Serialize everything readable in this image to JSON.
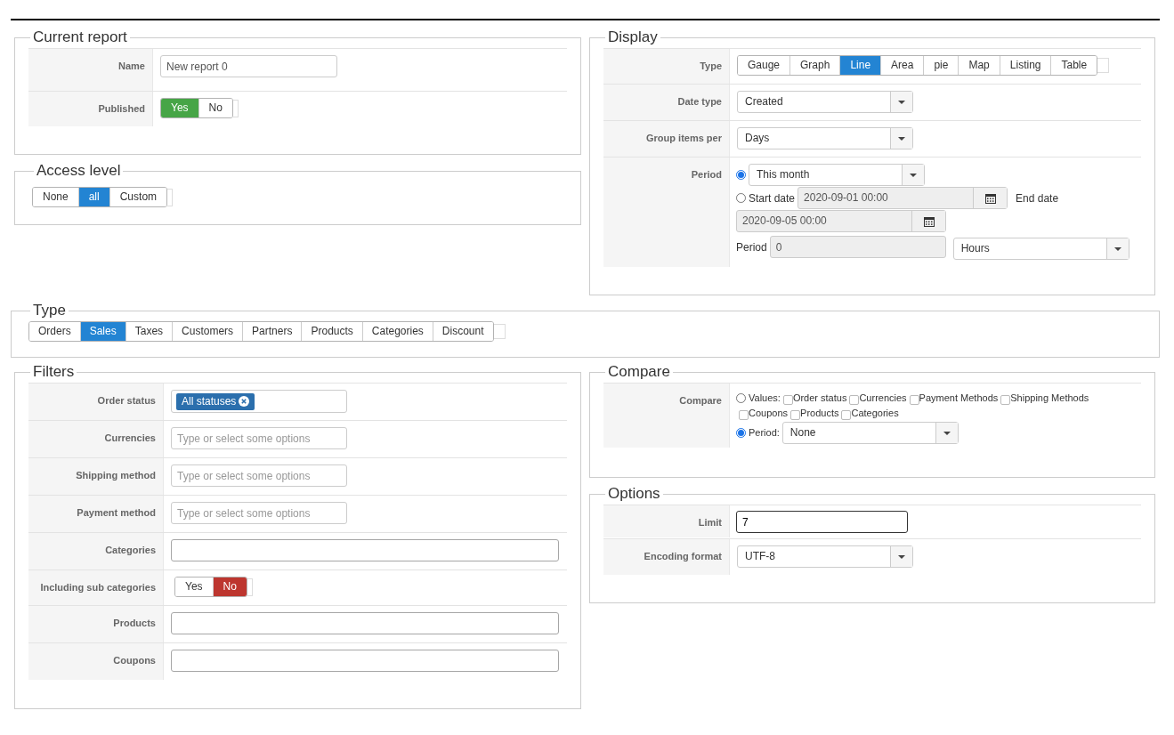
{
  "current_report": {
    "title": "Current report",
    "name": {
      "label": "Name",
      "value": "New report 0"
    },
    "published": {
      "label": "Published",
      "options": [
        {
          "label": "Yes",
          "selected": true,
          "color": "#46a546"
        },
        {
          "label": "No",
          "selected": false
        }
      ]
    }
  },
  "access_level": {
    "title": "Access level",
    "options": [
      {
        "label": "None",
        "selected": false
      },
      {
        "label": "all",
        "selected": true,
        "color": "#2384d3"
      },
      {
        "label": "Custom",
        "selected": false
      }
    ]
  },
  "display": {
    "title": "Display",
    "type": {
      "label": "Type",
      "options": [
        {
          "label": "Gauge",
          "selected": false
        },
        {
          "label": "Graph",
          "selected": false
        },
        {
          "label": "Line",
          "selected": true
        },
        {
          "label": "Area",
          "selected": false
        },
        {
          "label": "pie",
          "selected": false
        },
        {
          "label": "Map",
          "selected": false
        },
        {
          "label": "Listing",
          "selected": false
        },
        {
          "label": "Table",
          "selected": false
        }
      ]
    },
    "date_type": {
      "label": "Date type",
      "value": "Created"
    },
    "group_items_per": {
      "label": "Group items per",
      "value": "Days"
    },
    "period": {
      "label": "Period",
      "preset": {
        "selected": true,
        "value": "This month"
      },
      "range": {
        "selected": false,
        "start_label": "Start date",
        "start_value": "2020-09-01 00:00",
        "end_label": "End date",
        "end_value": "2020-09-05 00:00"
      },
      "period_label": "Period",
      "period_value": "0",
      "unit": "Hours"
    }
  },
  "type": {
    "title": "Type",
    "options": [
      {
        "label": "Orders",
        "selected": false
      },
      {
        "label": "Sales",
        "selected": true
      },
      {
        "label": "Taxes",
        "selected": false
      },
      {
        "label": "Customers",
        "selected": false
      },
      {
        "label": "Partners",
        "selected": false
      },
      {
        "label": "Products",
        "selected": false
      },
      {
        "label": "Categories",
        "selected": false
      },
      {
        "label": "Discount",
        "selected": false
      }
    ]
  },
  "filters": {
    "title": "Filters",
    "rows": [
      {
        "kind": "tags",
        "label": "Order status",
        "tags": [
          "All statuses"
        ]
      },
      {
        "kind": "multiselect",
        "label": "Currencies",
        "placeholder": "Type or select some options"
      },
      {
        "kind": "multiselect",
        "label": "Shipping method",
        "placeholder": "Type or select some options"
      },
      {
        "kind": "multiselect",
        "label": "Payment method",
        "placeholder": "Type or select some options"
      },
      {
        "kind": "text",
        "label": "Categories"
      },
      {
        "kind": "toggle",
        "label": "Including sub categories",
        "options": [
          {
            "label": "Yes",
            "selected": false
          },
          {
            "label": "No",
            "selected": true,
            "color": "#bd362f"
          }
        ]
      },
      {
        "kind": "text",
        "label": "Products"
      },
      {
        "kind": "text",
        "label": "Coupons"
      }
    ]
  },
  "compare": {
    "title": "Compare",
    "label": "Compare",
    "values_option": {
      "label": "Values:",
      "selected": false,
      "checkboxes": [
        {
          "label": "Order status",
          "checked": false
        },
        {
          "label": "Currencies",
          "checked": false
        },
        {
          "label": "Payment Methods",
          "checked": false
        },
        {
          "label": "Shipping Methods",
          "checked": false
        },
        {
          "label": "Coupons",
          "checked": false
        },
        {
          "label": "Products",
          "checked": false
        },
        {
          "label": "Categories",
          "checked": false
        }
      ]
    },
    "period_option": {
      "label": "Period:",
      "selected": true,
      "value": "None"
    }
  },
  "options": {
    "title": "Options",
    "limit": {
      "label": "Limit",
      "value": "7"
    },
    "encoding": {
      "label": "Encoding format",
      "value": "UTF-8"
    }
  }
}
